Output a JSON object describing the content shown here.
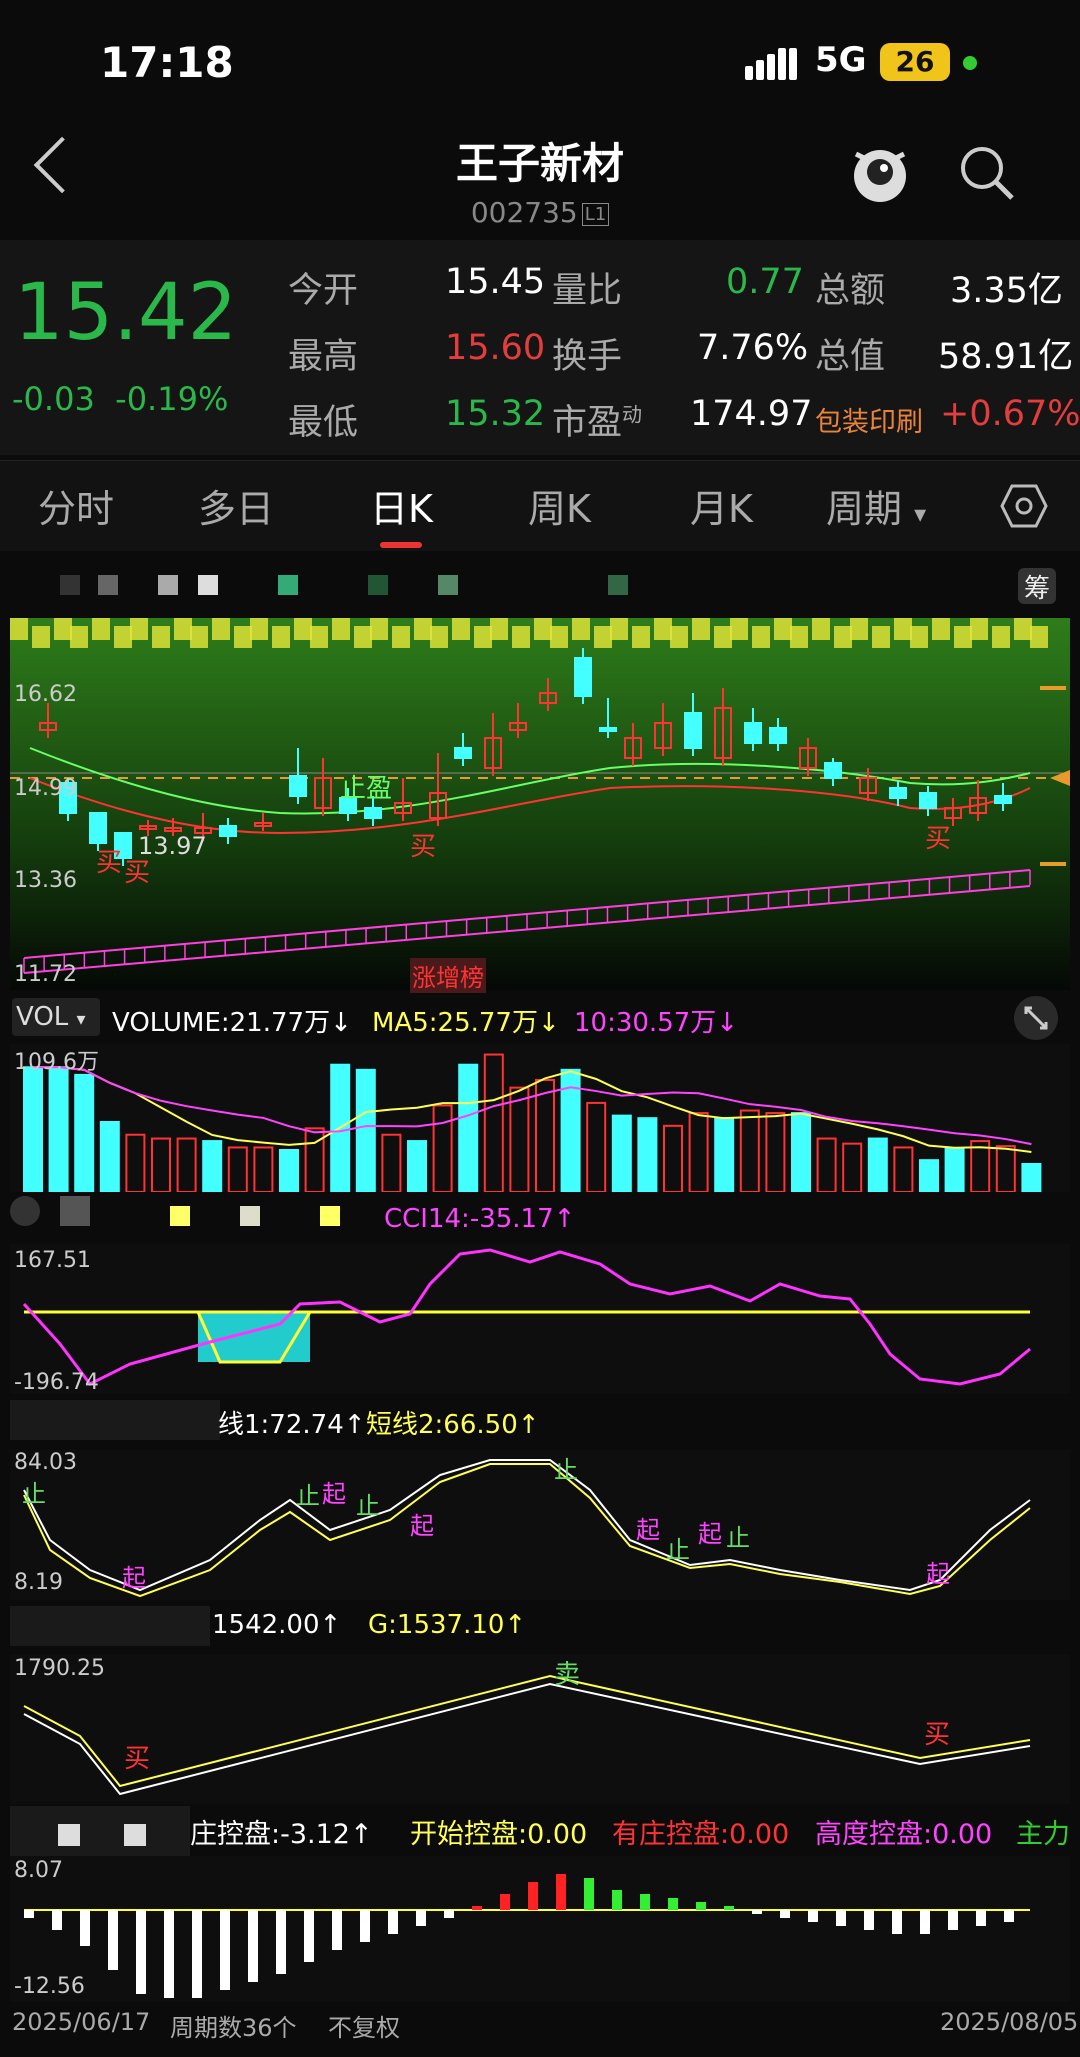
{
  "status_bar": {
    "time": "17:18",
    "network": "5G",
    "battery": "26"
  },
  "header": {
    "title": "王子新材",
    "code": "002735",
    "level": "L1"
  },
  "quote": {
    "price": "15.42",
    "change": "-0.03",
    "change_pct": "-0.19%",
    "rows": [
      {
        "l1": "今开",
        "v1": "15.45",
        "l2": "量比",
        "v2": "0.77",
        "l3": "总额",
        "v3": "3.35亿"
      },
      {
        "l1": "最高",
        "v1": "15.60",
        "l2": "换手",
        "v2": "7.76%",
        "l3": "总值",
        "v3": "58.91亿"
      },
      {
        "l1": "最低",
        "v1": "15.32",
        "l2": "市盈",
        "v2": "174.97",
        "l3": "包装印刷",
        "v3": "+0.67%"
      }
    ],
    "pe_sup": "动",
    "colors": {
      "up": "#e33d3d",
      "down": "#2bb84a",
      "sector": "#e8843a"
    }
  },
  "tabs": [
    {
      "label": "分时"
    },
    {
      "label": "多日"
    },
    {
      "label": "日K"
    },
    {
      "label": "周K"
    },
    {
      "label": "月K"
    },
    {
      "label": "周期"
    }
  ],
  "kline": {
    "side_label": "筹",
    "y_labels": [
      "16.62",
      "14.99",
      "13.36",
      "11.72"
    ],
    "min_label": "13.97",
    "annotations": {
      "buy": "买",
      "stop": "止盈",
      "sell": "卖",
      "rank": "涨增榜"
    }
  },
  "volume": {
    "selector": "VOL",
    "volume": "VOLUME:21.77万↓",
    "ma5": "MA5:25.77万↓",
    "ma10": "10:30.57万↓",
    "max_label": "109.6万",
    "bars": [
      98,
      98,
      92,
      55,
      45,
      42,
      42,
      40,
      35,
      35,
      33,
      50,
      100,
      96,
      45,
      40,
      68,
      100,
      108,
      82,
      88,
      96,
      70,
      60,
      58,
      52,
      62,
      58,
      64,
      62,
      62,
      42,
      38,
      42,
      35,
      25,
      34,
      40,
      36,
      22
    ]
  },
  "cci": {
    "label": "CCI14:-35.17↑",
    "top": "167.51",
    "bottom": "-196.74"
  },
  "short": {
    "label1": "线1:72.74↑",
    "label2": "短线2:66.50↑",
    "top": "84.03",
    "bottom": "8.19",
    "tags": {
      "stop": "止",
      "start": "起"
    }
  },
  "gline": {
    "label1": "1542.00↑",
    "label2": "G:1537.10↑",
    "top": "1790.25",
    "buy": "买",
    "sell": "卖"
  },
  "control": {
    "l1": "庄控盘:-3.12↑",
    "l2": "开始控盘:0.00",
    "l3": "有庄控盘:0.00",
    "l4": "高度控盘:0.00",
    "l5": "主力",
    "top": "8.07",
    "bottom": "-12.56"
  },
  "footer": {
    "start": "2025/06/17",
    "periods": "周期数36个",
    "adjust": "不复权",
    "end": "2025/08/05"
  }
}
